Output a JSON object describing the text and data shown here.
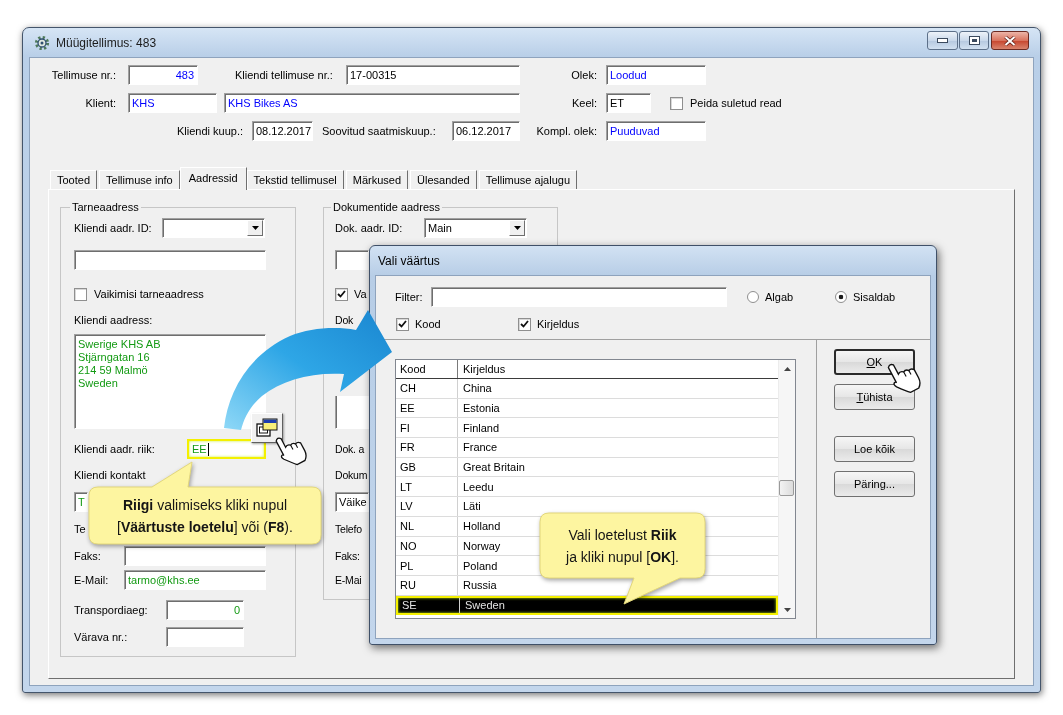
{
  "window": {
    "title": "Müügitellimus: 483"
  },
  "header": {
    "order_no": {
      "label": "Tellimuse nr.:",
      "value": "483",
      "color": "#0000ff"
    },
    "customer_order_no": {
      "label": "Kliendi tellimuse nr.:",
      "value": "17-00315",
      "color": "#000000"
    },
    "status": {
      "label": "Olek:",
      "value": "Loodud",
      "color": "#0000ff"
    },
    "customer": {
      "label": "Klient:",
      "code": "KHS",
      "name": "KHS Bikes AS",
      "color": "#0000ff"
    },
    "language": {
      "label": "Keel:",
      "value": "ET",
      "color": "#000000"
    },
    "hide_closed_rows": {
      "label": "Peida suletud read",
      "checked": false
    },
    "customer_date": {
      "label": "Kliendi kuup.:",
      "value": "08.12.2017",
      "color": "#000000"
    },
    "requested_ship_date": {
      "label": "Soovitud saatmiskuup.:",
      "value": "06.12.2017",
      "color": "#000000"
    },
    "completion_status": {
      "label": "Kompl. olek:",
      "value": "Puuduvad",
      "color": "#0000ff"
    }
  },
  "tabs": [
    {
      "label": "Tooted",
      "selected": false
    },
    {
      "label": "Tellimuse info",
      "selected": false
    },
    {
      "label": "Aadressid",
      "selected": true
    },
    {
      "label": "Tekstid tellimusel",
      "selected": false
    },
    {
      "label": "Märkused",
      "selected": false
    },
    {
      "label": "Ülesanded",
      "selected": false
    },
    {
      "label": "Tellimuse ajalugu",
      "selected": false
    }
  ],
  "delivery_address": {
    "title": "Tarneaadress",
    "color": "#139a13",
    "address_id": {
      "label": "Kliendi aadr. ID:"
    },
    "default_address": {
      "label": "Vaikimisi tarneaadress",
      "checked": false
    },
    "address": {
      "label": "Kliendi aadress:",
      "lines": [
        "Swerige KHS AB",
        "Stjärngatan 16",
        "214 59 Malmö",
        "Sweden"
      ]
    },
    "country": {
      "label": "Kliendi aadr. riik:",
      "value": "EE",
      "highlighted": true,
      "focused": true
    },
    "contact": {
      "label": "Kliendi kontakt",
      "value": "T"
    },
    "phone": {
      "label": "Te"
    },
    "fax": {
      "label": "Faks:"
    },
    "email": {
      "label": "E-Mail:",
      "value": "tarmo@khs.ee"
    },
    "transport_days": {
      "label": "Transpordiaeg:",
      "value": "0"
    },
    "gate_no": {
      "label": "Värava nr.:"
    }
  },
  "document_address": {
    "title": "Dokumentide aadress",
    "address_id": {
      "label": "Dok. aadr. ID:",
      "value": "Main"
    },
    "default_address": {
      "label": "Va",
      "checked": true
    },
    "address_label": "Dok",
    "country_label": "Dok. a",
    "contact": {
      "label": "Dokum",
      "value": "Väike",
      "color": "#000000"
    },
    "phone_label": "Telefo",
    "fax_label": "Faks:",
    "email_label": "E-Mai"
  },
  "dialog": {
    "title": "Vali väärtus",
    "filter": {
      "label": "Filter:"
    },
    "match_modes": [
      {
        "label": "Algab",
        "selected": false
      },
      {
        "label": "Sisaldab",
        "selected": true
      }
    ],
    "search_fields": [
      {
        "label": "Kood",
        "checked": true
      },
      {
        "label": "Kirjeldus",
        "checked": true
      }
    ],
    "table": {
      "columns": [
        "Kood",
        "Kirjeldus"
      ],
      "rows": [
        {
          "code": "CH",
          "description": "China",
          "selected": false
        },
        {
          "code": "EE",
          "description": "Estonia",
          "selected": false
        },
        {
          "code": "FI",
          "description": "Finland",
          "selected": false
        },
        {
          "code": "FR",
          "description": "France",
          "selected": false
        },
        {
          "code": "GB",
          "description": "Great Britain",
          "selected": false
        },
        {
          "code": "LT",
          "description": "Leedu",
          "selected": false
        },
        {
          "code": "LV",
          "description": "Läti",
          "selected": false
        },
        {
          "code": "NL",
          "description": "Holland",
          "selected": false
        },
        {
          "code": "NO",
          "description": "Norway",
          "selected": false
        },
        {
          "code": "PL",
          "description": "Poland",
          "selected": false
        },
        {
          "code": "RU",
          "description": "Russia",
          "selected": false
        },
        {
          "code": "SE",
          "description": "Sweden",
          "selected": true
        }
      ]
    },
    "buttons": [
      {
        "label": "OK",
        "access_key_underlined": true,
        "default": true
      },
      {
        "label": "Tühista",
        "access_key_underlined": true,
        "default": false
      },
      {
        "label": "Loe kõik",
        "access_key_underlined": false,
        "default": false
      },
      {
        "label": "Päring...",
        "access_key_underlined": false,
        "default": false
      }
    ]
  },
  "callouts": [
    {
      "lines": [
        "**Riigi** valimiseks kliki nupul",
        "[**Väärtuste loetelu**] või (**F8**)."
      ]
    },
    {
      "lines": [
        "Vali loetelust **Riik**",
        "ja kliki nupul [**OK**]."
      ]
    }
  ]
}
